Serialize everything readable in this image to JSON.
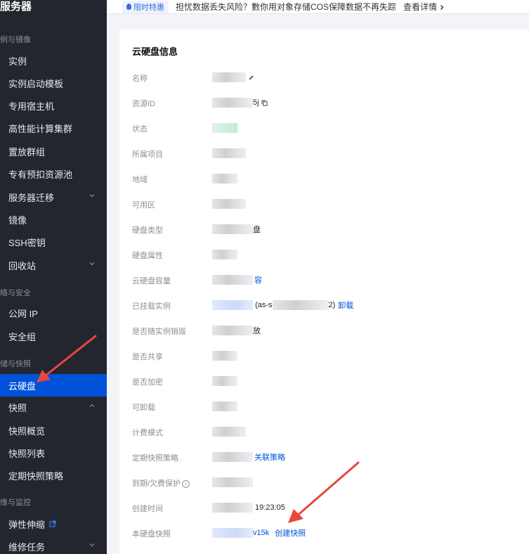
{
  "sidebar": {
    "title": "服务器",
    "sections": {
      "instances": "例与镜像",
      "network": "络与安全",
      "storage": "储与快照",
      "ops": "维与监控"
    },
    "items": [
      {
        "label": "实例"
      },
      {
        "label": "实例启动模板"
      },
      {
        "label": "专用宿主机"
      },
      {
        "label": "高性能计算集群"
      },
      {
        "label": "置放群组"
      },
      {
        "label": "专有预扣资源池"
      },
      {
        "label": "服务器迁移"
      },
      {
        "label": "镜像"
      },
      {
        "label": "SSH密钥"
      },
      {
        "label": "回收站"
      },
      {
        "label": "公网 IP"
      },
      {
        "label": "安全组"
      },
      {
        "label": "云硬盘"
      },
      {
        "label": "快照"
      },
      {
        "label": "快照概览"
      },
      {
        "label": "快照列表"
      },
      {
        "label": "定期快照策略"
      },
      {
        "label": "弹性伸缩"
      },
      {
        "label": "维修任务"
      }
    ]
  },
  "banner": {
    "badge": "限时特惠",
    "text": "担忧数据丢失风险？數你用对象存储COS保障数据不再失踪",
    "link": "查看详情"
  },
  "panel": {
    "title": "云硬盘信息",
    "rows": {
      "name": {
        "label": "名称"
      },
      "resource_id": {
        "label": "资源ID",
        "suffix": "5j"
      },
      "status": {
        "label": "状态"
      },
      "project": {
        "label": "所属项目"
      },
      "region": {
        "label": "地域"
      },
      "zone": {
        "label": "可用区"
      },
      "disk_type": {
        "label": "硬盘类型",
        "suffix": "盘"
      },
      "disk_attr": {
        "label": "硬盘属性"
      },
      "capacity": {
        "label": "云硬盘容量",
        "link": "容"
      },
      "attached": {
        "label": "已挂载实例",
        "prefix": "(as-s",
        "suffix": "2)",
        "link": "卸载"
      },
      "destroy_with": {
        "label": "是否随实例销毁",
        "suffix": "放"
      },
      "shared": {
        "label": "是否共享"
      },
      "encrypted": {
        "label": "是否加密"
      },
      "detachable": {
        "label": "可卸载"
      },
      "billing": {
        "label": "计费模式"
      },
      "snapshot_policy": {
        "label": "定期快照策略",
        "link": "关联策略"
      },
      "expire_protect": {
        "label": "到期/欠费保护"
      },
      "created": {
        "label": "创建时间",
        "suffix": "19:23:05"
      },
      "snapshots": {
        "label": "本硬盘快照",
        "suffix": "v15k",
        "link": "创建快照"
      }
    }
  },
  "colors": {
    "sidebar_bg": "#23262e",
    "active": "#0052d9",
    "link": "#0052d9",
    "arrow": "#e8473d"
  }
}
